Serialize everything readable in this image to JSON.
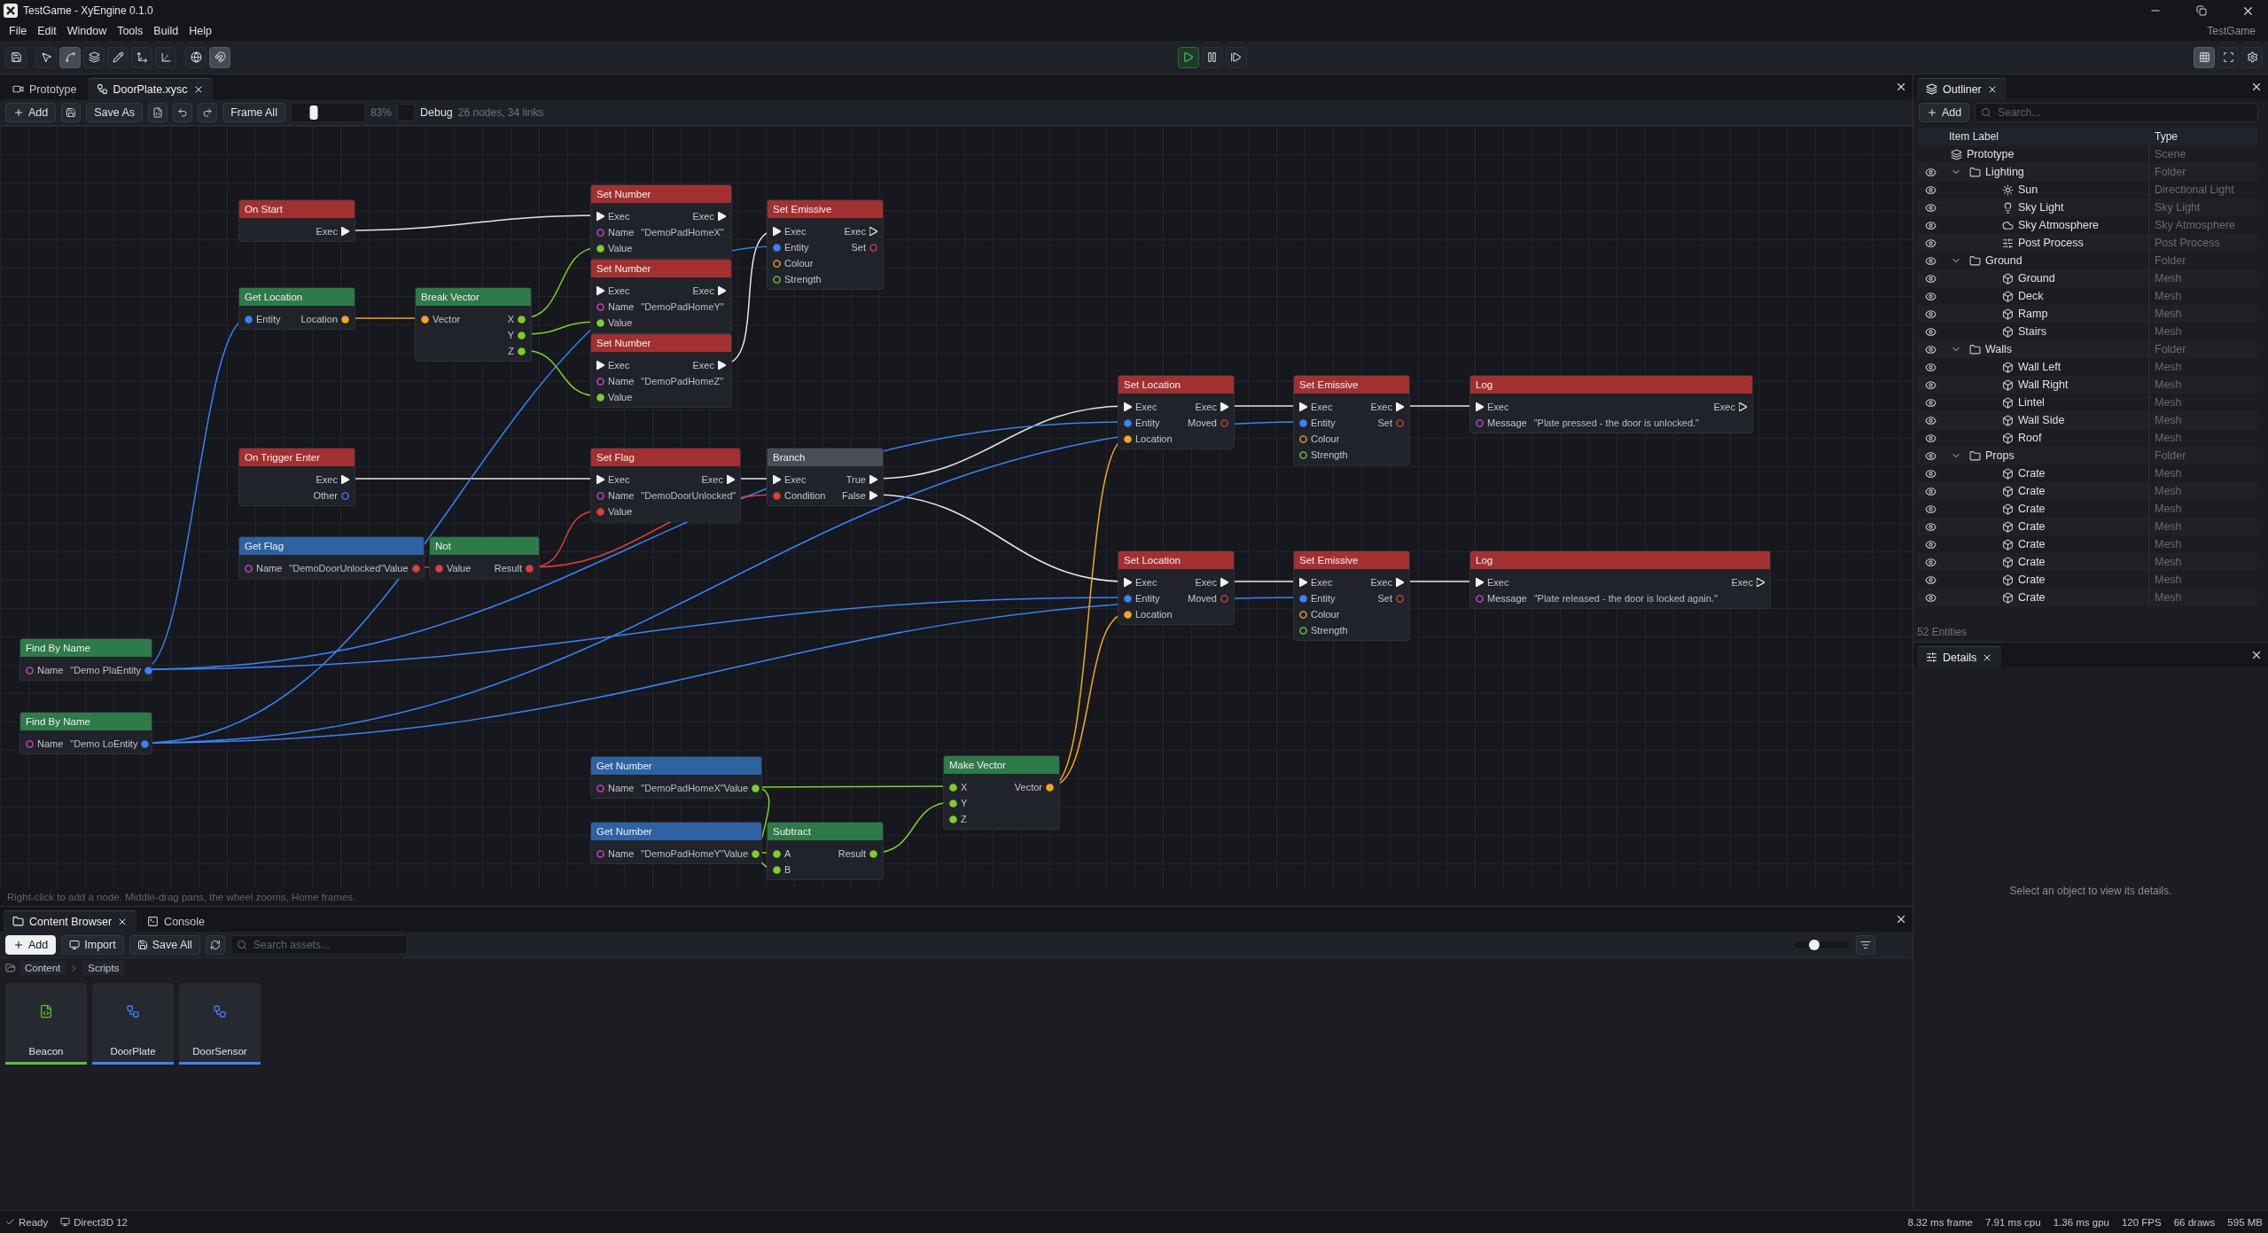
{
  "window": {
    "title": "TestGame - XyEngine 0.1.0"
  },
  "menu": [
    "File",
    "Edit",
    "Window",
    "Tools",
    "Build",
    "Help"
  ],
  "project": "TestGame",
  "toolbar": {
    "tools": [
      {
        "selected": false
      },
      {
        "selected": false
      },
      {
        "selected": true
      },
      {
        "selected": false
      },
      {
        "selected": false
      },
      {
        "selected": false
      },
      {
        "selected": false
      },
      {
        "selected": false
      },
      {
        "selected": true
      }
    ],
    "playback": [
      {
        "selected": true
      },
      {
        "selected": false
      },
      {
        "selected": false
      }
    ],
    "view": [
      {
        "selected": true
      },
      {
        "selected": false
      },
      {
        "selected": false
      }
    ]
  },
  "doc_tabs": [
    {
      "label": "Prototype",
      "selected": false
    },
    {
      "label": "DoorPlate.xysc",
      "selected": true
    }
  ],
  "graph_toolbar": {
    "add": "Add",
    "save_as": "Save As",
    "frame_all": "Frame All",
    "zoom": {
      "level": 0.3
    },
    "zoom_reading": "83%",
    "debug": {
      "label": "Debug",
      "checked": false
    },
    "stats": "26 nodes, 34 links"
  },
  "nodes": [
    {
      "title": "On Start",
      "color": "#a33030",
      "rows": [
        {
          "right": {
            "kind": "exec",
            "label": "Exec",
            "connected": true
          }
        }
      ]
    },
    {
      "title": "Set Number",
      "color": "#a33030",
      "rows": [
        {
          "left": {
            "kind": "exec",
            "label": "Exec",
            "connected": true
          },
          "right": {
            "kind": "exec",
            "label": "Exec",
            "connected": true
          }
        },
        {
          "left": {
            "kind": "string",
            "label": "Name",
            "value": "\"DemoPadHomeX\"",
            "connected": false
          }
        },
        {
          "left": {
            "kind": "number",
            "label": "Value",
            "connected": true
          }
        }
      ]
    },
    {
      "title": "Set Number",
      "color": "#a33030",
      "rows": [
        {
          "left": {
            "kind": "exec",
            "label": "Exec",
            "connected": true
          },
          "right": {
            "kind": "exec",
            "label": "Exec",
            "connected": true
          }
        },
        {
          "left": {
            "kind": "string",
            "label": "Name",
            "value": "\"DemoPadHomeY\"",
            "connected": false
          }
        },
        {
          "left": {
            "kind": "number",
            "label": "Value",
            "connected": true
          }
        }
      ]
    },
    {
      "title": "Set Number",
      "color": "#a33030",
      "rows": [
        {
          "left": {
            "kind": "exec",
            "label": "Exec",
            "connected": true
          },
          "right": {
            "kind": "exec",
            "label": "Exec",
            "connected": true
          }
        },
        {
          "left": {
            "kind": "string",
            "label": "Name",
            "value": "\"DemoPadHomeZ\"",
            "connected": false
          }
        },
        {
          "left": {
            "kind": "number",
            "label": "Value",
            "connected": true
          }
        }
      ]
    },
    {
      "title": "Set Emissive",
      "color": "#a33030",
      "rows": [
        {
          "left": {
            "kind": "exec",
            "label": "Exec",
            "connected": true
          },
          "right": {
            "kind": "exec",
            "label": "Exec",
            "connected": false
          }
        },
        {
          "left": {
            "kind": "entity",
            "label": "Entity",
            "connected": true
          },
          "right": {
            "kind": "bool",
            "label": "Set",
            "connected": false
          }
        },
        {
          "left": {
            "kind": "vector",
            "label": "Colour",
            "connected": false
          }
        },
        {
          "left": {
            "kind": "number",
            "label": "Strength",
            "connected": false
          }
        }
      ]
    },
    {
      "title": "Get Location",
      "color": "#2e7a48",
      "rows": [
        {
          "left": {
            "kind": "entity",
            "label": "Entity",
            "connected": true
          },
          "right": {
            "kind": "vector",
            "label": "Location",
            "connected": true
          }
        }
      ]
    },
    {
      "title": "Break Vector",
      "color": "#2e7a48",
      "rows": [
        {
          "left": {
            "kind": "vector",
            "label": "Vector",
            "connected": true
          },
          "right": {
            "kind": "number",
            "label": "X",
            "connected": true
          }
        },
        {
          "right": {
            "kind": "number",
            "label": "Y",
            "connected": true
          }
        },
        {
          "right": {
            "kind": "number",
            "label": "Z",
            "connected": true
          }
        }
      ]
    },
    {
      "title": "On Trigger Enter",
      "color": "#a33030",
      "rows": [
        {
          "right": {
            "kind": "exec",
            "label": "Exec",
            "connected": true
          }
        },
        {
          "right": {
            "kind": "entity",
            "label": "Other",
            "connected": false
          }
        }
      ]
    },
    {
      "title": "Set Flag",
      "color": "#a33030",
      "rows": [
        {
          "left": {
            "kind": "exec",
            "label": "Exec",
            "connected": true
          },
          "right": {
            "kind": "exec",
            "label": "Exec",
            "connected": true
          }
        },
        {
          "left": {
            "kind": "string",
            "label": "Name",
            "value": "\"DemoDoorUnlocked\"",
            "connected": false
          }
        },
        {
          "left": {
            "kind": "bool",
            "label": "Value",
            "connected": true
          }
        }
      ]
    },
    {
      "title": "Branch",
      "color": "#4a4d55",
      "rows": [
        {
          "left": {
            "kind": "exec",
            "label": "Exec",
            "connected": true
          },
          "right": {
            "kind": "exec",
            "label": "True",
            "connected": true
          }
        },
        {
          "left": {
            "kind": "bool",
            "label": "Condition",
            "connected": true
          },
          "right": {
            "kind": "exec",
            "label": "False",
            "connected": true
          }
        }
      ]
    },
    {
      "title": "Get Flag",
      "color": "#2d62a3",
      "rows": [
        {
          "left": {
            "kind": "string",
            "label": "Name",
            "value": "\"DemoDoorUnlocked\"",
            "connected": false
          },
          "right": {
            "kind": "bool",
            "label": "Value",
            "connected": true
          }
        }
      ]
    },
    {
      "title": "Not",
      "color": "#2e7a48",
      "rows": [
        {
          "left": {
            "kind": "bool",
            "label": "Value",
            "connected": true
          },
          "right": {
            "kind": "bool",
            "label": "Result",
            "connected": true
          }
        }
      ]
    },
    {
      "title": "Set Location",
      "color": "#a33030",
      "rows": [
        {
          "left": {
            "kind": "exec",
            "label": "Exec",
            "connected": true
          },
          "right": {
            "kind": "exec",
            "label": "Exec",
            "connected": true
          }
        },
        {
          "left": {
            "kind": "entity",
            "label": "Entity",
            "connected": true
          },
          "right": {
            "kind": "bool",
            "label": "Moved",
            "connected": false
          }
        },
        {
          "left": {
            "kind": "vector",
            "label": "Location",
            "connected": true
          }
        }
      ]
    },
    {
      "title": "Set Emissive",
      "color": "#a33030",
      "rows": [
        {
          "left": {
            "kind": "exec",
            "label": "Exec",
            "connected": true
          },
          "right": {
            "kind": "exec",
            "label": "Exec",
            "connected": true
          }
        },
        {
          "left": {
            "kind": "entity",
            "label": "Entity",
            "connected": true
          },
          "right": {
            "kind": "bool",
            "label": "Set",
            "connected": false
          }
        },
        {
          "left": {
            "kind": "vector",
            "label": "Colour",
            "connected": false
          }
        },
        {
          "left": {
            "kind": "number",
            "label": "Strength",
            "connected": false
          }
        }
      ]
    },
    {
      "title": "Log",
      "color": "#a33030",
      "rows": [
        {
          "left": {
            "kind": "exec",
            "label": "Exec",
            "connected": true
          },
          "right": {
            "kind": "exec",
            "label": "Exec",
            "connected": false
          }
        },
        {
          "left": {
            "kind": "string",
            "label": "Message",
            "value": "\"Plate pressed - the door is unlocked.\"",
            "connected": false
          }
        }
      ]
    },
    {
      "title": "Set Location",
      "color": "#a33030",
      "rows": [
        {
          "left": {
            "kind": "exec",
            "label": "Exec",
            "connected": true
          },
          "right": {
            "kind": "exec",
            "label": "Exec",
            "connected": true
          }
        },
        {
          "left": {
            "kind": "entity",
            "label": "Entity",
            "connected": true
          },
          "right": {
            "kind": "bool",
            "label": "Moved",
            "connected": false
          }
        },
        {
          "left": {
            "kind": "vector",
            "label": "Location",
            "connected": true
          }
        }
      ]
    },
    {
      "title": "Set Emissive",
      "color": "#a33030",
      "rows": [
        {
          "left": {
            "kind": "exec",
            "label": "Exec",
            "connected": true
          },
          "right": {
            "kind": "exec",
            "label": "Exec",
            "connected": true
          }
        },
        {
          "left": {
            "kind": "entity",
            "label": "Entity",
            "connected": true
          },
          "right": {
            "kind": "bool",
            "label": "Set",
            "connected": false
          }
        },
        {
          "left": {
            "kind": "vector",
            "label": "Colour",
            "connected": false
          }
        },
        {
          "left": {
            "kind": "number",
            "label": "Strength",
            "connected": false
          }
        }
      ]
    },
    {
      "title": "Log",
      "color": "#a33030",
      "rows": [
        {
          "left": {
            "kind": "exec",
            "label": "Exec",
            "connected": true
          },
          "right": {
            "kind": "exec",
            "label": "Exec",
            "connected": false
          }
        },
        {
          "left": {
            "kind": "string",
            "label": "Message",
            "value": "\"Plate released - the door is locked again.\"",
            "connected": false
          }
        }
      ]
    },
    {
      "title": "Find By Name",
      "color": "#2e7a48",
      "rows": [
        {
          "left": {
            "kind": "string",
            "label": "Name",
            "value": "\"Demo Pla",
            "connected": false
          },
          "right": {
            "kind": "entity",
            "label": "Entity",
            "connected": true
          }
        }
      ]
    },
    {
      "title": "Find By Name",
      "color": "#2e7a48",
      "rows": [
        {
          "left": {
            "kind": "string",
            "label": "Name",
            "value": "\"Demo Lo",
            "connected": false
          },
          "right": {
            "kind": "entity",
            "label": "Entity",
            "connected": true
          }
        }
      ]
    },
    {
      "title": "Get Number",
      "color": "#2d62a3",
      "rows": [
        {
          "left": {
            "kind": "string",
            "label": "Name",
            "value": "\"DemoPadHomeX\"",
            "connected": false
          },
          "right": {
            "kind": "number",
            "label": "Value",
            "connected": true
          }
        }
      ]
    },
    {
      "title": "Get Number",
      "color": "#2d62a3",
      "rows": [
        {
          "left": {
            "kind": "string",
            "label": "Name",
            "value": "\"DemoPadHomeY\"",
            "connected": false
          },
          "right": {
            "kind": "number",
            "label": "Value",
            "connected": true
          }
        }
      ]
    },
    {
      "title": "Subtract",
      "color": "#2e7a48",
      "rows": [
        {
          "left": {
            "kind": "number",
            "label": "A",
            "connected": true
          },
          "right": {
            "kind": "number",
            "label": "Result",
            "connected": true
          }
        },
        {
          "left": {
            "kind": "number",
            "label": "B",
            "connected": true
          }
        }
      ]
    },
    {
      "title": "Make Vector",
      "color": "#2e7a48",
      "rows": [
        {
          "left": {
            "kind": "number",
            "label": "X",
            "connected": true
          },
          "right": {
            "kind": "vector",
            "label": "Vector",
            "connected": true
          }
        },
        {
          "left": {
            "kind": "number",
            "label": "Y",
            "connected": true
          }
        },
        {
          "left": {
            "kind": "number",
            "label": "Z",
            "connected": true
          }
        }
      ]
    }
  ],
  "canvas_hint": "Right-click to add a node.  Middle-drag pans, the wheel zooms, Home frames.",
  "bottom_tabs": [
    {
      "label": "Content Browser",
      "selected": true
    },
    {
      "label": "Console",
      "selected": false
    }
  ],
  "content_toolbar": {
    "add": "Add",
    "import": "Import",
    "save_all": "Save All",
    "search": {
      "placeholder": "Search assets..."
    },
    "thumb_size": {
      "level": 0.35
    }
  },
  "breadcrumb": [
    "Content",
    "Scripts"
  ],
  "assets": [
    {
      "name": "Beacon",
      "color": "#5bbf3a",
      "kind": "script"
    },
    {
      "name": "DoorPlate",
      "color": "#3b82f6",
      "kind": "graph"
    },
    {
      "name": "DoorSensor",
      "color": "#3b82f6",
      "kind": "graph"
    }
  ],
  "outliner": {
    "title": "Outliner",
    "add": "Add",
    "search": {
      "placeholder": "Search..."
    },
    "columns": [
      "Item Label",
      "Type"
    ],
    "root": {
      "label": "Prototype",
      "type": "Scene",
      "kind": "scene",
      "children": [
        {
          "label": "Lighting",
          "type": "Folder",
          "kind": "folder",
          "visible": true,
          "expanded": true,
          "children": [
            {
              "label": "Sun",
              "type": "Directional Light",
              "kind": "sun",
              "visible": true
            },
            {
              "label": "Sky Light",
              "type": "Sky Light",
              "kind": "bulb",
              "visible": true
            },
            {
              "label": "Sky Atmosphere",
              "type": "Sky Atmosphere",
              "kind": "cloud",
              "visible": true
            },
            {
              "label": "Post Process",
              "type": "Post Process",
              "kind": "sliders",
              "visible": true
            }
          ]
        },
        {
          "label": "Ground",
          "type": "Folder",
          "kind": "folder",
          "visible": true,
          "expanded": true,
          "children": [
            {
              "label": "Ground",
              "type": "Mesh",
              "kind": "mesh",
              "visible": true
            },
            {
              "label": "Deck",
              "type": "Mesh",
              "kind": "mesh",
              "visible": true
            },
            {
              "label": "Ramp",
              "type": "Mesh",
              "kind": "mesh",
              "visible": true
            },
            {
              "label": "Stairs",
              "type": "Mesh",
              "kind": "mesh",
              "visible": true
            }
          ]
        },
        {
          "label": "Walls",
          "type": "Folder",
          "kind": "folder",
          "visible": true,
          "expanded": true,
          "children": [
            {
              "label": "Wall Left",
              "type": "Mesh",
              "kind": "mesh",
              "visible": true
            },
            {
              "label": "Wall Right",
              "type": "Mesh",
              "kind": "mesh",
              "visible": true
            },
            {
              "label": "Lintel",
              "type": "Mesh",
              "kind": "mesh",
              "visible": true
            },
            {
              "label": "Wall Side",
              "type": "Mesh",
              "kind": "mesh",
              "visible": true
            },
            {
              "label": "Roof",
              "type": "Mesh",
              "kind": "mesh",
              "visible": true
            }
          ]
        },
        {
          "label": "Props",
          "type": "Folder",
          "kind": "folder",
          "visible": true,
          "expanded": true,
          "children": [
            {
              "label": "Crate",
              "type": "Mesh",
              "kind": "mesh",
              "visible": true
            },
            {
              "label": "Crate",
              "type": "Mesh",
              "kind": "mesh",
              "visible": true
            },
            {
              "label": "Crate",
              "type": "Mesh",
              "kind": "mesh",
              "visible": true
            },
            {
              "label": "Crate",
              "type": "Mesh",
              "kind": "mesh",
              "visible": true
            },
            {
              "label": "Crate",
              "type": "Mesh",
              "kind": "mesh",
              "visible": true
            },
            {
              "label": "Crate",
              "type": "Mesh",
              "kind": "mesh",
              "visible": true
            },
            {
              "label": "Crate",
              "type": "Mesh",
              "kind": "mesh",
              "visible": true
            },
            {
              "label": "Crate",
              "type": "Mesh",
              "kind": "mesh",
              "visible": true
            }
          ]
        }
      ]
    },
    "footer": "52 Entities"
  },
  "details": {
    "title": "Details",
    "empty": "Select an object to view its details."
  },
  "status_bar": {
    "ready": "Ready",
    "backend": "Direct3D 12",
    "stats": [
      "8.32 ms frame",
      "7.91 ms cpu",
      "1.36 ms gpu",
      "120 FPS",
      "66 draws",
      "595 MB"
    ]
  }
}
